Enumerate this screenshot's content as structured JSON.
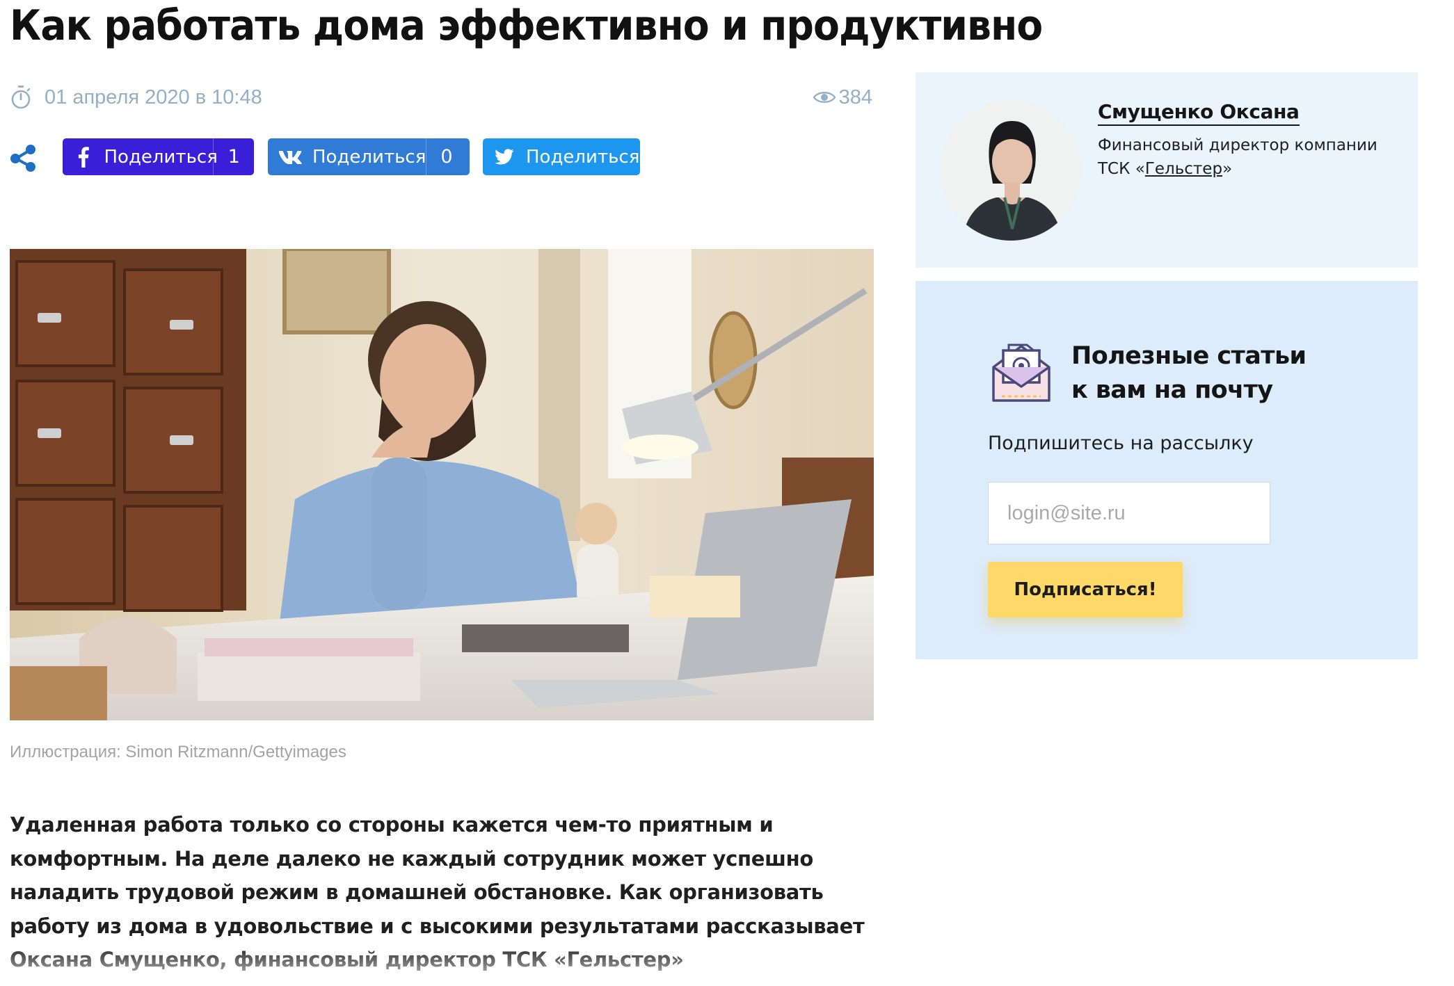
{
  "article": {
    "title": "Как работать дома эффективно и продуктивно",
    "date": "01 апреля 2020 в 10:48",
    "views": "384",
    "photo_caption": "Иллюстрация: Simon Ritzmann/Gettyimages",
    "lead": "Удаленная работа только со стороны кажется чем-то приятным и комфортным. На деле далеко не каждый сотрудник может успешно наладить трудовой режим в домашней обстановке. Как организовать работу из дома в удовольствие и с высокими результатами рассказывает Оксана Смущенко, финансовый директор ТСК «Гельстер»"
  },
  "share": {
    "facebook": {
      "label": "Поделиться",
      "count": "1",
      "color": "#3a1fd8",
      "icon": "facebook-icon"
    },
    "vk": {
      "label": "Поделиться",
      "count": "0",
      "color": "#2f7bd6",
      "icon": "vk-icon"
    },
    "twitter": {
      "label": "Поделиться",
      "color": "#1d96ef",
      "icon": "twitter-icon"
    }
  },
  "author": {
    "name": "Смущенко Оксана",
    "role_prefix": "Финансовый директор компании ТСК «",
    "company": "Гельстер",
    "role_suffix": "»"
  },
  "newsletter": {
    "title_line1": "Полезные статьи",
    "title_line2": "к вам на почту",
    "subtitle": "Подпишитесь на рассылку",
    "email_placeholder": "login@site.ru",
    "email_value": "",
    "button_label": "Подписаться!",
    "button_color": "#fed96a",
    "icon": "envelope-at-icon"
  },
  "theme": {
    "meta_color": "#93b0c6",
    "author_card_bg": "#e9f4fd",
    "newsletter_bg": "#dcecfb",
    "share_icon_color": "#1e6ec8"
  }
}
